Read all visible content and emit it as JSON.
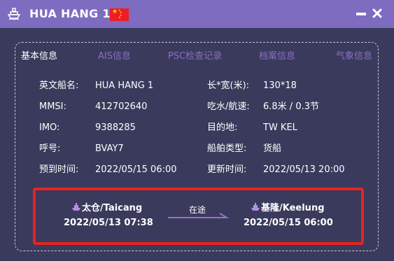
{
  "window": {
    "title": "HUA HANG 1",
    "flag": "china-flag",
    "colors": {
      "titlebar": "#7d6cc0",
      "background": "#3a3a5c",
      "tab_inactive": "#8c6fc4",
      "highlight_border": "#e8231f"
    }
  },
  "tabs": [
    {
      "label": "基本信息",
      "active": true
    },
    {
      "label": "AIS信息",
      "active": false
    },
    {
      "label": "PSC检查记录",
      "active": false
    },
    {
      "label": "档案信息",
      "active": false
    },
    {
      "label": "气象信息",
      "active": false
    }
  ],
  "info": {
    "english_name_label": "英文船名:",
    "english_name": "HUA HANG 1",
    "mmsi_label": "MMSI:",
    "mmsi": "412702640",
    "imo_label": "IMO:",
    "imo": "9388285",
    "callsign_label": "呼号:",
    "callsign": "BVAY7",
    "eta_label": "预到时间:",
    "eta": "2022/05/15 06:00",
    "dimensions_label": "长*宽(米):",
    "dimensions": "130*18",
    "draft_speed_label": "吃水/航速:",
    "draft_speed": "6.8米 / 0.3节",
    "destination_label": "目的地:",
    "destination": "TW KEL",
    "ship_type_label": "船舶类型:",
    "ship_type": "货船",
    "updated_label": "更新时间:",
    "updated": "2022/05/13 20:00"
  },
  "route": {
    "from_port": "太仓/Taicang",
    "from_time": "2022/05/13 07:38",
    "status": "在途",
    "to_port": "基隆/Keelung",
    "to_time": "2022/05/15 06:00"
  }
}
